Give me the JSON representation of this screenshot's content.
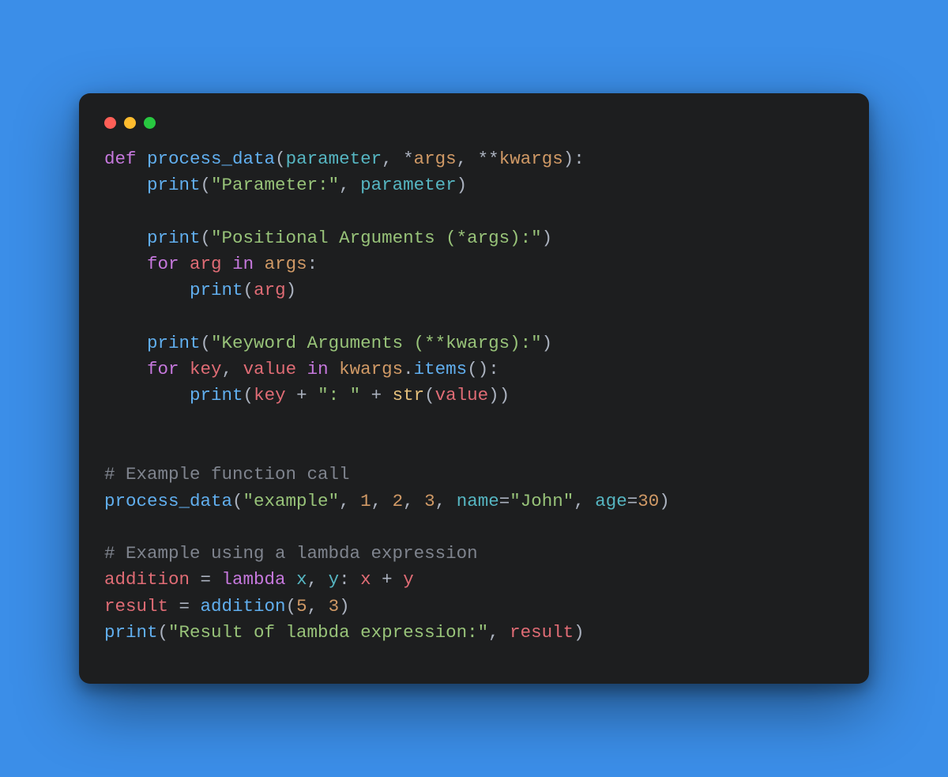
{
  "window": {
    "traffic_lights": {
      "red": "#ff5f57",
      "yellow": "#febc2e",
      "green": "#28c840"
    }
  },
  "code": {
    "tokens": {
      "def": "def",
      "for": "for",
      "in": "in",
      "lambda": "lambda",
      "process_data": "process_data",
      "parameter": "parameter",
      "args": "args",
      "kwargs": "kwargs",
      "print": "print",
      "items": "items",
      "arg": "arg",
      "key": "key",
      "value": "value",
      "str": "str",
      "addition": "addition",
      "result": "result",
      "x": "x",
      "y": "y",
      "name_kw": "name",
      "age_kw": "age"
    },
    "strings": {
      "parameter_label": "\"Parameter:\"",
      "positional_label": "\"Positional Arguments (*args):\"",
      "keyword_label": "\"Keyword Arguments (**kwargs):\"",
      "colon_space": "\": \"",
      "example": "\"example\"",
      "john": "\"John\"",
      "lambda_result_label": "\"Result of lambda expression:\""
    },
    "numbers": {
      "one": "1",
      "two": "2",
      "three": "3",
      "thirty": "30",
      "five": "5",
      "three_b": "3"
    },
    "comments": {
      "example_call": "# Example function call",
      "example_lambda": "# Example using a lambda expression"
    },
    "punct": {
      "lparen": "(",
      "rparen": ")",
      "comma_sp": ", ",
      "colon": ":",
      "star": "*",
      "dstar": "**",
      "eq_sp": " = ",
      "eq": "=",
      "plus_sp": " + ",
      "dot": "."
    }
  }
}
